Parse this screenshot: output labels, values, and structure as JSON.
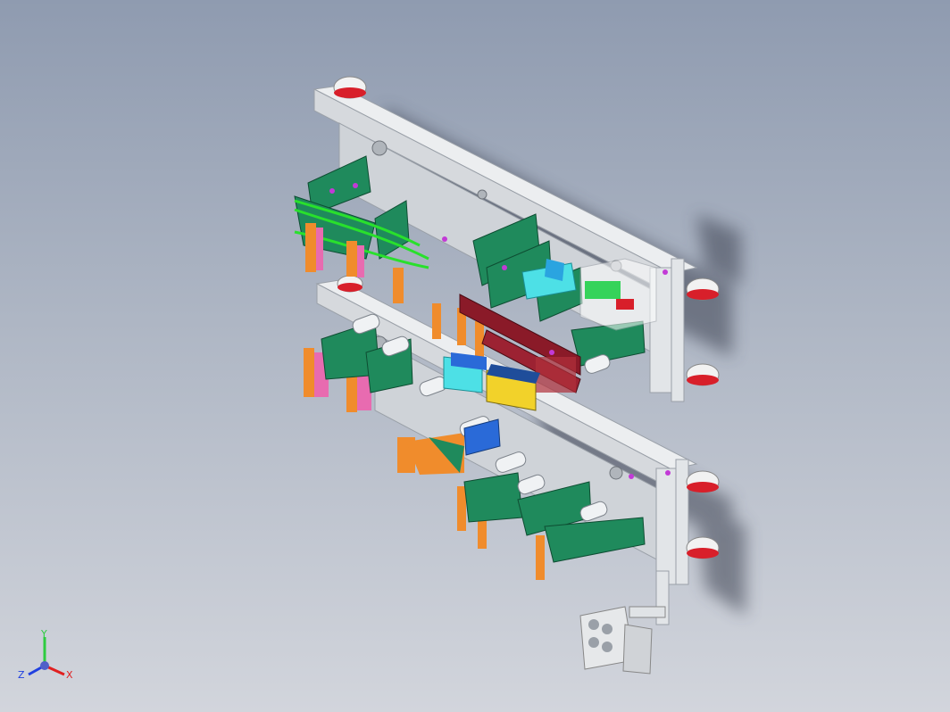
{
  "viewport": {
    "background_top": "#8f9bb0",
    "background_bottom": "#d2d5dc"
  },
  "model": {
    "frame_color": "#e6e8ea",
    "green_part_color": "#1f8a5c",
    "orange_part_color": "#f08c2c",
    "pink_part_color": "#e86bb0",
    "red_bar_color": "#8a1a28",
    "yellow_part_color": "#f2d22a",
    "blue_part_color": "#2a6ad8",
    "cyan_part_color": "#4de0e6",
    "wheel_color": "#d81f2a"
  },
  "triad": {
    "y_label": "Y",
    "x_label": "X",
    "z_label": "Z",
    "y_color": "#2ecc40",
    "x_color": "#e02020",
    "z_color": "#2040e0"
  }
}
